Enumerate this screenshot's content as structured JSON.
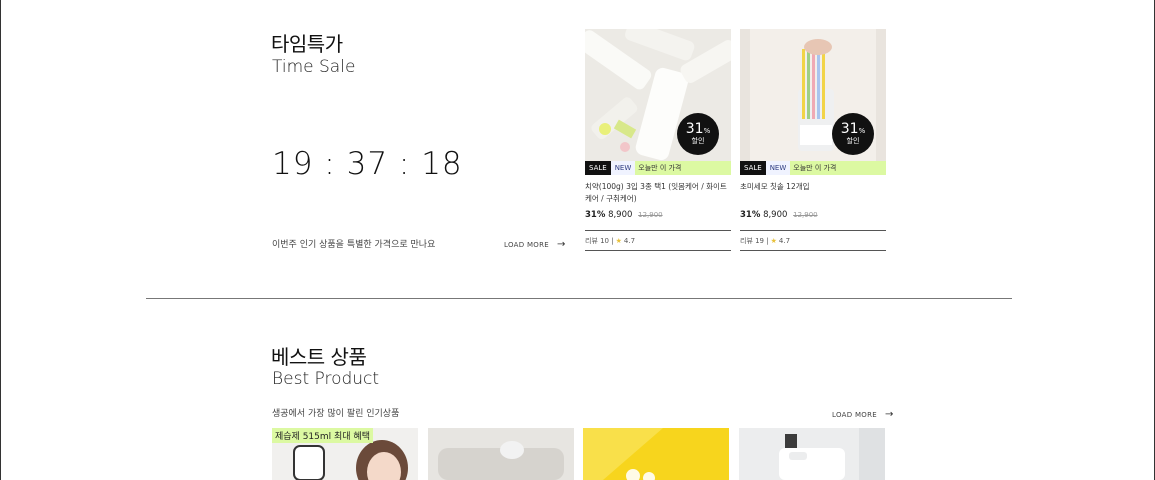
{
  "time_sale": {
    "title_ko": "타임특가",
    "title_en": "Time Sale",
    "timer": "19 : 37 : 18",
    "description": "이번주 인기 상품을 특별한 가격으로 만나요",
    "load_more": "LOAD MORE",
    "products": [
      {
        "badge_percent": "31",
        "badge_percent_sign": "%",
        "badge_label": "할인",
        "tag_sale": "SALE",
        "tag_new": "NEW",
        "tag_today": "오늘만 이 가격",
        "name": "치약(100g) 3입 3종 택1 (잇몸케어 / 화이트케어 / 구취케어)",
        "discount": "31%",
        "price": "8,900",
        "original_price": "12,900",
        "review": "리뷰 10 |",
        "rating": "4.7"
      },
      {
        "badge_percent": "31",
        "badge_percent_sign": "%",
        "badge_label": "할인",
        "tag_sale": "SALE",
        "tag_new": "NEW",
        "tag_today": "오늘만 이 가격",
        "name": "초미세모 칫솔 12개입",
        "discount": "31%",
        "price": "8,900",
        "original_price": "12,900",
        "review": "리뷰 19 |",
        "rating": "4.7"
      }
    ]
  },
  "best_product": {
    "title_ko": "베스트 상품",
    "title_en": "Best Product",
    "description": "생공에서 가장 많이 팔린 인기상품",
    "load_more": "LOAD MORE",
    "first_badge": "제습제 515ml 최대 혜택"
  },
  "icons": {
    "arrow": "arrow-right-icon",
    "star": "star-icon"
  },
  "colors": {
    "promo_bg": "#dcf9a2",
    "badge_bg": "#111111",
    "accent_yellow": "#f7d51d"
  }
}
